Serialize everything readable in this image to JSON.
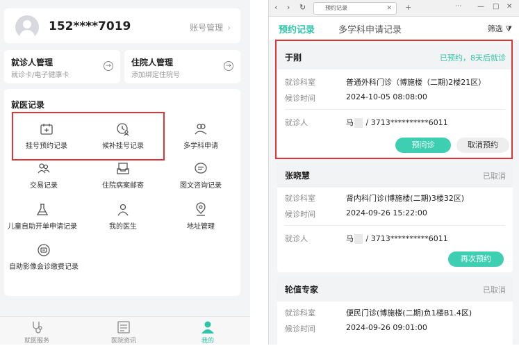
{
  "left": {
    "user": {
      "phone": "152****7019",
      "account_link": "账号管理"
    },
    "patient_mgmt": {
      "title": "就诊人管理",
      "sub": "就诊卡/电子健康卡"
    },
    "inpatient_mgmt": {
      "title": "住院人管理",
      "sub": "添加绑定住院号"
    },
    "records": {
      "title": "就医记录",
      "items": [
        {
          "label": "挂号预约记录",
          "icon": "calendar-plus-icon"
        },
        {
          "label": "候补挂号记录",
          "icon": "clock-person-icon"
        },
        {
          "label": "多学科申请",
          "icon": "group-icon"
        },
        {
          "label": "交易记录",
          "icon": "people-icon"
        },
        {
          "label": "住院病案邮寄",
          "icon": "mail-tray-icon"
        },
        {
          "label": "图文咨询记录",
          "icon": "chat-icon"
        },
        {
          "label": "儿童自助开单申请记录",
          "icon": "flask-icon"
        },
        {
          "label": "我的医生",
          "icon": "doctor-icon"
        },
        {
          "label": "地址管理",
          "icon": "location-icon"
        },
        {
          "label": "自助影像会诊缴费记录",
          "icon": "scan-icon"
        }
      ]
    },
    "tabbar": [
      {
        "label": "就医服务",
        "icon": "stethoscope-icon"
      },
      {
        "label": "医院资讯",
        "icon": "news-icon"
      },
      {
        "label": "我的",
        "icon": "profile-icon"
      }
    ]
  },
  "right": {
    "browser_tab": "预约记录",
    "tabs": {
      "active": "预约记录",
      "other": "多学科申请记录",
      "filter": "筛选"
    },
    "appointments": [
      {
        "name": "于刚",
        "status": "已预约，8天后就诊",
        "dept_label": "就诊科室",
        "dept": "普通外科门诊（博施楼（二期)2楼21区）",
        "time_label": "候诊时间",
        "time": "2024-10-05  08:08:00",
        "patient_label": "就诊人",
        "patient_prefix": "马",
        "patient_suffix": " / 3713**********6011",
        "btn1": "预问诊",
        "btn2": "取消预约"
      },
      {
        "name": "张晓慧",
        "status": "已取消",
        "dept_label": "就诊科室",
        "dept": "肾内科门诊(博施楼(二期)3楼32区)",
        "time_label": "候诊时间",
        "time": "2024-09-26  15:22:00",
        "patient_label": "就诊人",
        "patient_prefix": "马",
        "patient_suffix": " / 3713**********6011",
        "btn1": "再次预约"
      },
      {
        "name": "轮值专家",
        "status": "已取消",
        "dept_label": "就诊科室",
        "dept": "便民门诊(博施楼(二期)负1楼B1.4区)",
        "time_label": "候诊时间",
        "time": "2024-09-26  09:01:00"
      }
    ]
  }
}
